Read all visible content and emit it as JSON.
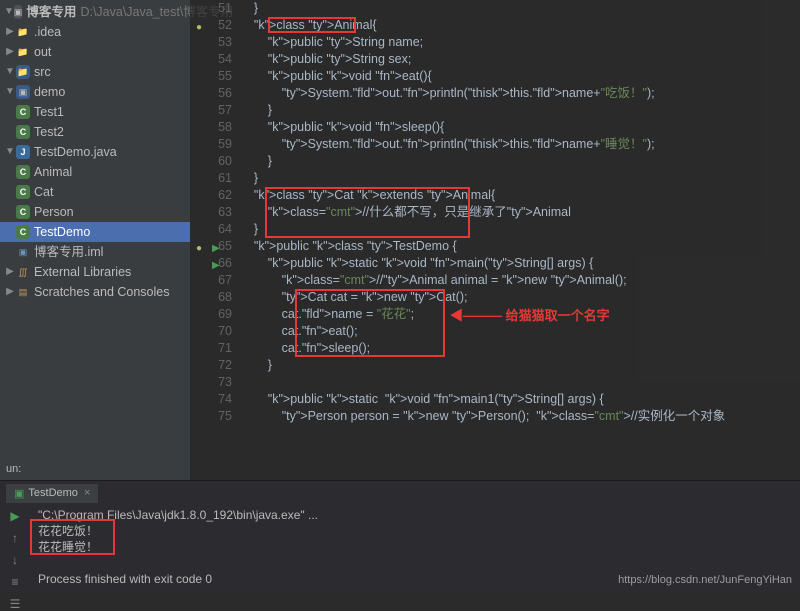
{
  "sidebar": {
    "project": {
      "name": "博客专用",
      "path": "D:\\Java\\Java_test\\博客专用"
    },
    "idea": ".idea",
    "out": "out",
    "src": "src",
    "demo": "demo",
    "test1": "Test1",
    "test2": "Test2",
    "testDemo": "TestDemo.java",
    "cls_animal": "Animal",
    "cls_cat": "Cat",
    "cls_person": "Person",
    "cls_testdemo": "TestDemo",
    "iml": "博客专用.iml",
    "ext": "External Libraries",
    "scratches": "Scratches and Consoles"
  },
  "code": {
    "lines": {
      "51": "    }",
      "52": "    class Animal{",
      "53": "        public String name;",
      "54": "        public String sex;",
      "55": "        public void eat(){",
      "56": "            System.out.println(this.name+\"吃饭！\");",
      "57": "        }",
      "58": "        public void sleep(){",
      "59": "            System.out.println(this.name+\"睡觉！\");",
      "60": "        }",
      "61": "    }",
      "62": "    class Cat extends Animal{",
      "63": "        //什么都不写，只是继承了Animal",
      "64": "    }",
      "65": "    public class TestDemo {",
      "66": "        public static void main(String[] args) {",
      "67": "            //Animal animal = new Animal();",
      "68": "            Cat cat = new Cat();",
      "69": "            cat.name = \"花花\";",
      "70": "            cat.eat();",
      "71": "            cat.sleep();",
      "72": "        }",
      "73": "",
      "74": "        public static  void main1(String[] args) {",
      "75": "            Person person = new Person();  //实例化一个对象"
    },
    "annotation": "给猫猫取一个名字"
  },
  "run": {
    "title": "un:",
    "tab": "TestDemo",
    "cmd": "\"C:\\Program Files\\Java\\jdk1.8.0_192\\bin\\java.exe\" ...",
    "out1": "花花吃饭！",
    "out2": "花花睡觉！",
    "exit": "Process finished with exit code 0"
  },
  "watermark": "https://blog.csdn.net/JunFengYiHan"
}
